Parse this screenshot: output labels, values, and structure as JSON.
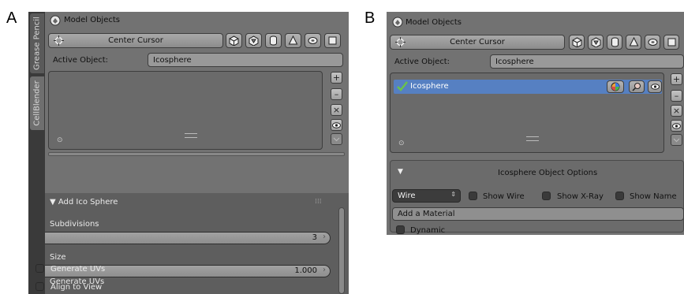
{
  "figure": {
    "label_a": "A",
    "label_b": "B"
  },
  "panel_a": {
    "tabs": [
      "Grease Pencil",
      "CellBlender"
    ],
    "header": "Model Objects",
    "center_cursor": "Center Cursor",
    "active_object_label": "Active Object:",
    "active_object_value": "Icosphere",
    "section_title": "Add Ico Sphere",
    "subdivisions_label": "Subdivisions",
    "subdivisions_value": "3",
    "size_label": "Size",
    "size_value": "1.000",
    "generate_uvs": "Generate UVs",
    "align_to_view": "Align to View"
  },
  "panel_b": {
    "header": "Model Objects",
    "center_cursor": "Center Cursor",
    "active_object_label": "Active Object:",
    "active_object_value": "Icosphere",
    "list_item": "Icosphere",
    "options_title": "Icosphere Object Options",
    "display_type": "Wire",
    "show_wire": "Show Wire",
    "show_xray": "Show X-Ray",
    "show_name": "Show Name",
    "add_material": "Add a Material",
    "dynamic": "Dynamic"
  },
  "colors": {
    "panel_bg": "#727272",
    "selected_row": "#5680c2",
    "dark_section": "#5e5e5e",
    "checkmark": "#6ac24a"
  },
  "icons": [
    "model-objects-icon",
    "crosshair-icon",
    "cube-icon",
    "ico-sphere-icon",
    "cylinder-icon",
    "cone-icon",
    "torus-icon",
    "plane-icon",
    "plus-icon",
    "minus-icon",
    "x-icon",
    "eye-icon",
    "chevron-down-icon",
    "checkmark-icon",
    "color-wheel-icon",
    "magnifier-icon"
  ]
}
